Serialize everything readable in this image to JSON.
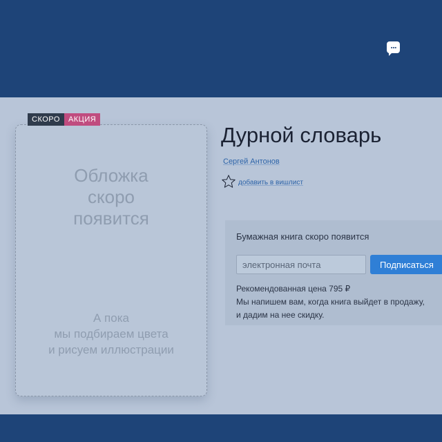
{
  "header": {
    "chat_icon_text": "..."
  },
  "badges": {
    "soon": "СКОРО",
    "promo": "АКЦИЯ"
  },
  "cover": {
    "placeholder_title": "Обложка\nскоро\nпоявится",
    "placeholder_subtitle": "А пока\nмы подбираем цвета\nи рисуем иллюстрации"
  },
  "book": {
    "title": "Дурной словарь",
    "author": "Сергей Антонов",
    "wishlist_label": "добавить в вишлист"
  },
  "subscribe": {
    "heading": "Бумажная книга скоро появится",
    "email_placeholder": "электронная почта",
    "email_value": "",
    "button_label": "Подписаться",
    "price_text": "Рекомендованная цена 795 ₽",
    "info_line_1": "Мы напишем вам, когда книга выйдет в продажу,",
    "info_line_2": "и дадим на нее скидку."
  },
  "colors": {
    "header_bg": "#1e4478",
    "page_bg": "#b8c5d8",
    "accent_blue": "#2f7fd6",
    "badge_dark": "#2f3b4c",
    "badge_pink": "#c04c7f",
    "link": "#2c63a8"
  },
  "icons": {
    "chat": "chat-bubble-icon",
    "wishlist": "star-outline-icon"
  }
}
